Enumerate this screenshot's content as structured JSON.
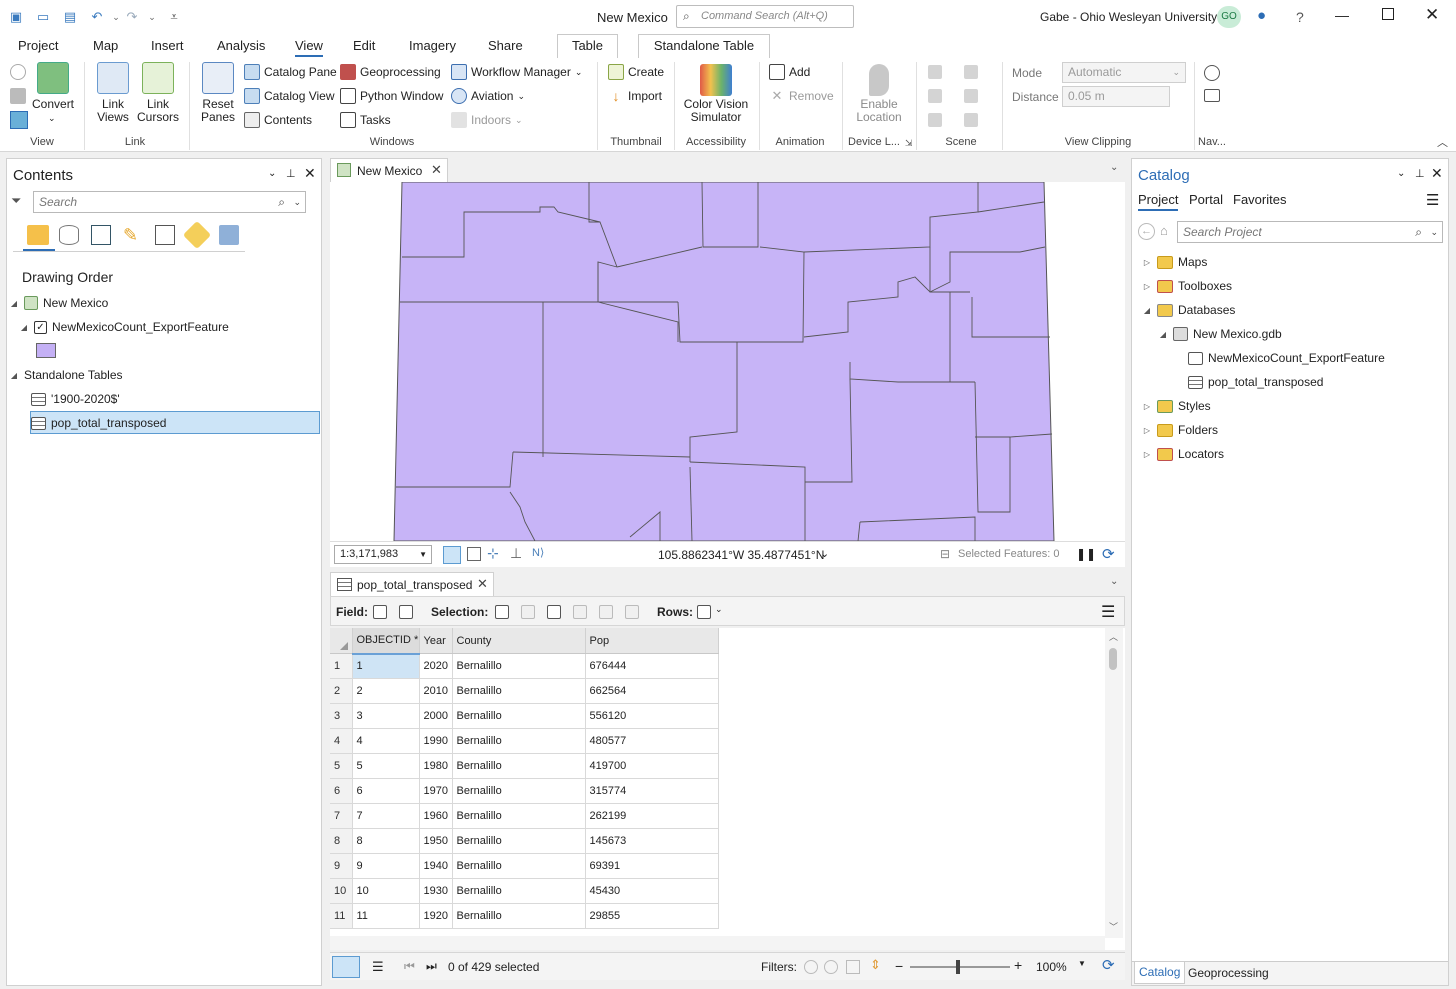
{
  "window": {
    "title": "New Mexico",
    "command_search_placeholder": "Command Search (Alt+Q)",
    "user": "Gabe - Ohio Wesleyan University",
    "user_initials": "GO",
    "help": "?"
  },
  "menu": {
    "tabs": [
      "Project",
      "Map",
      "Insert",
      "Analysis",
      "View",
      "Edit",
      "Imagery",
      "Share"
    ],
    "active": "View",
    "context_tabs": [
      "Table",
      "Standalone Table"
    ]
  },
  "ribbon": {
    "view_group": {
      "convert": "Convert",
      "label": "View"
    },
    "link_group": {
      "link_views": "Link\nViews",
      "link_cursors": "Link\nCursors",
      "label": "Link"
    },
    "windows_group": {
      "reset_panes": "Reset\nPanes",
      "catalog_pane": "Catalog Pane",
      "catalog_view": "Catalog View",
      "contents": "Contents",
      "geoprocessing": "Geoprocessing",
      "python_window": "Python Window",
      "tasks": "Tasks",
      "workflow_manager": "Workflow Manager",
      "aviation": "Aviation",
      "indoors": "Indoors",
      "label": "Windows"
    },
    "thumbnail_group": {
      "create": "Create",
      "import": "Import",
      "label": "Thumbnail"
    },
    "accessibility_group": {
      "color_vision": "Color Vision\nSimulator",
      "label": "Accessibility"
    },
    "animation_group": {
      "add": "Add",
      "remove": "Remove",
      "label": "Animation"
    },
    "device_group": {
      "enable_location": "Enable\nLocation",
      "label": "Device L..."
    },
    "scene_group": {
      "label": "Scene"
    },
    "view_clipping_group": {
      "mode_label": "Mode",
      "mode_value": "Automatic",
      "distance_label": "Distance",
      "distance_value": "0.05  m",
      "label": "View Clipping"
    },
    "nav_group": {
      "label": "Nav..."
    }
  },
  "contents": {
    "title": "Contents",
    "search_placeholder": "Search",
    "drawing_order": "Drawing Order",
    "map_name": "New Mexico",
    "layer": "NewMexicoCount_ExportFeature",
    "layer_color": "#c4b0f5",
    "standalone_tables": "Standalone Tables",
    "tables": [
      "'1900-2020$'",
      "pop_total_transposed"
    ]
  },
  "map": {
    "tab": "New Mexico",
    "scale": "1:3,171,983",
    "coordinates": "105.8862341°W 35.4877451°N",
    "selected_features": "Selected Features: 0",
    "fill": "#c7b4f7"
  },
  "table": {
    "tab": "pop_total_transposed",
    "field_label": "Field:",
    "selection_label": "Selection:",
    "rows_label": "Rows:",
    "columns": [
      "OBJECTID *",
      "Year",
      "County",
      "Pop"
    ],
    "rows": [
      [
        "1",
        "1",
        "2020",
        "Bernalillo",
        "676444"
      ],
      [
        "2",
        "2",
        "2010",
        "Bernalillo",
        "662564"
      ],
      [
        "3",
        "3",
        "2000",
        "Bernalillo",
        "556120"
      ],
      [
        "4",
        "4",
        "1990",
        "Bernalillo",
        "480577"
      ],
      [
        "5",
        "5",
        "1980",
        "Bernalillo",
        "419700"
      ],
      [
        "6",
        "6",
        "1970",
        "Bernalillo",
        "315774"
      ],
      [
        "7",
        "7",
        "1960",
        "Bernalillo",
        "262199"
      ],
      [
        "8",
        "8",
        "1950",
        "Bernalillo",
        "145673"
      ],
      [
        "9",
        "9",
        "1940",
        "Bernalillo",
        "69391"
      ],
      [
        "10",
        "10",
        "1930",
        "Bernalillo",
        "45430"
      ],
      [
        "11",
        "11",
        "1920",
        "Bernalillo",
        "29855"
      ]
    ],
    "status": "0 of 429 selected",
    "filters_label": "Filters:",
    "zoom": "100%"
  },
  "catalog": {
    "title": "Catalog",
    "tabs": [
      "Project",
      "Portal",
      "Favorites"
    ],
    "search_placeholder": "Search Project",
    "items": [
      "Maps",
      "Toolboxes",
      "Databases",
      "New Mexico.gdb",
      "NewMexicoCount_ExportFeature",
      "pop_total_transposed",
      "Styles",
      "Folders",
      "Locators"
    ],
    "bottom_tabs": [
      "Catalog",
      "Geoprocessing"
    ]
  }
}
